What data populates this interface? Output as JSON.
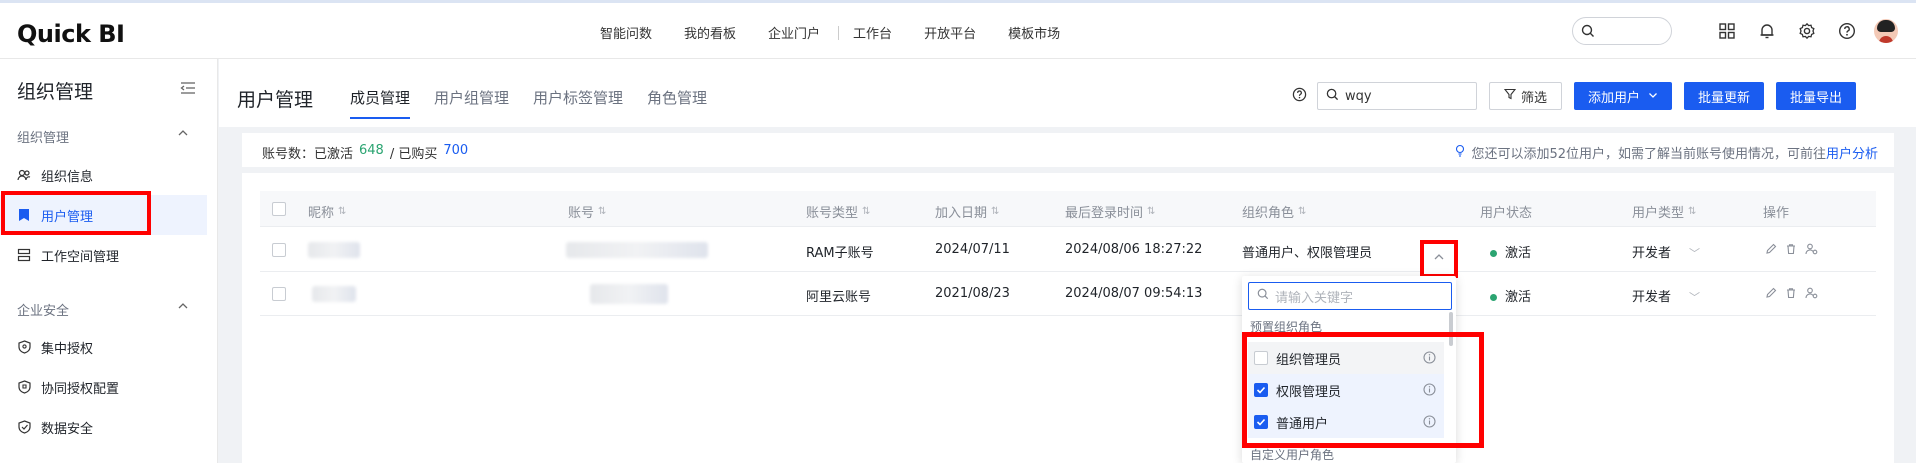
{
  "app": {
    "logo": "Quick BI"
  },
  "topnav": {
    "items": [
      "智能问数",
      "我的看板",
      "企业门户",
      "工作台",
      "开放平台",
      "模板市场"
    ]
  },
  "sidebar": {
    "title": "组织管理",
    "groups": [
      {
        "label": "组织管理",
        "items": [
          "组织信息",
          "用户管理",
          "工作空间管理"
        ]
      },
      {
        "label": "企业安全",
        "items": [
          "集中授权",
          "协同授权配置",
          "数据安全"
        ]
      }
    ],
    "active": "用户管理"
  },
  "header": {
    "title": "用户管理",
    "tabs": [
      "成员管理",
      "用户组管理",
      "用户标签管理",
      "角色管理"
    ],
    "active_tab": "成员管理",
    "search_value": "wqy",
    "filter_label": "筛选",
    "add_user_label": "添加用户",
    "batch_update_label": "批量更新",
    "batch_export_label": "批量导出"
  },
  "info": {
    "prefix": "账号数：已激活",
    "activated": "648",
    "sep": "/ 已购买",
    "purchased": "700",
    "tip": "您还可以添加52位用户，如需了解当前账号使用情况，可前往",
    "tip_link": "用户分析"
  },
  "table": {
    "columns": [
      "昵称",
      "账号",
      "账号类型",
      "加入日期",
      "最后登录时间",
      "组织角色",
      "用户状态",
      "用户类型",
      "操作"
    ],
    "rows": [
      {
        "type": "RAM子账号",
        "join_date": "2024/07/11",
        "last_login": "2024/08/06 18:27:22",
        "role": "普通用户、权限管理员",
        "status": "激活",
        "user_type": "开发者"
      },
      {
        "type": "阿里云账号",
        "join_date": "2021/08/23",
        "last_login": "2024/08/07 09:54:13",
        "role": "",
        "status": "激活",
        "user_type": "开发者"
      }
    ]
  },
  "dropdown": {
    "placeholder": "请输入关键字",
    "group1": "预置组织角色",
    "options": [
      {
        "label": "组织管理员",
        "checked": false
      },
      {
        "label": "权限管理员",
        "checked": true
      },
      {
        "label": "普通用户",
        "checked": true
      }
    ],
    "group2": "自定义用户角色"
  },
  "colors": {
    "primary": "#1a5cf0",
    "active_green": "#2ba471",
    "highlight_red": "#ff0000"
  }
}
